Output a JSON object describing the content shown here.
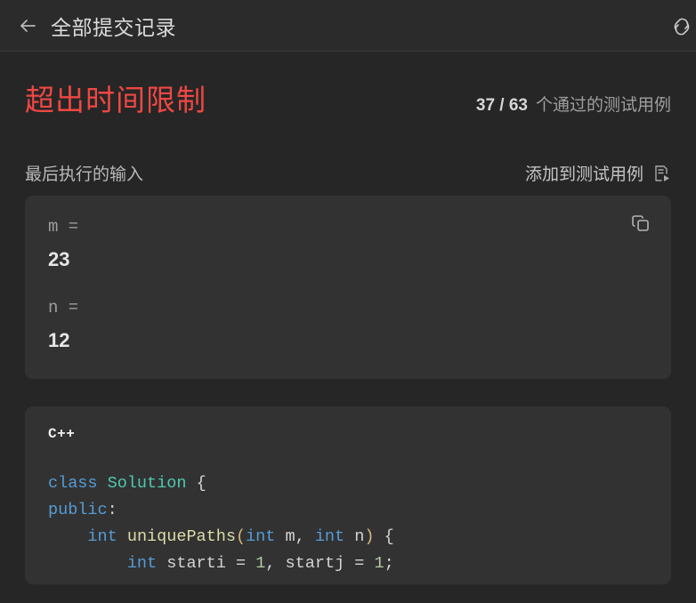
{
  "header": {
    "back_icon": "arrow-left-icon",
    "title": "全部提交记录",
    "link_icon": "link-icon"
  },
  "result": {
    "verdict": "超出时间限制",
    "cases_count": "37 / 63",
    "cases_label": "个通过的测试用例",
    "verdict_color": "#ef4743"
  },
  "input_section": {
    "label": "最后执行的输入",
    "add_testcase_label": "添加到测试用例",
    "add_testcase_icon": "file-run-icon",
    "copy_icon": "copy-icon",
    "fields": [
      {
        "key": "m =",
        "value": "23"
      },
      {
        "key": "n =",
        "value": "12"
      }
    ]
  },
  "code_section": {
    "language": "C++",
    "lines": [
      "class Solution {",
      "public:",
      "    int uniquePaths(int m, int n) {",
      "        int starti = 1, startj = 1;"
    ]
  },
  "colors": {
    "page_bg": "#262626",
    "panel_bg": "#323232",
    "header_bg": "#2b2b2b",
    "keyword": "#569cd6",
    "type": "#4ec9b0",
    "function": "#dcdcaa",
    "number": "#b5cea8",
    "plain": "#d4d4d4"
  }
}
